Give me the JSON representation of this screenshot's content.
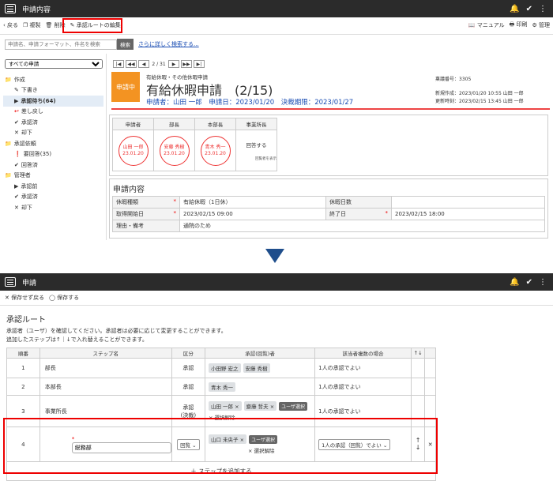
{
  "top": {
    "title": "申請内容",
    "toolbar": {
      "back": "戻る",
      "copy": "複製",
      "delete": "削除",
      "edit_route": "承認ルートの編集",
      "manual": "マニュアル",
      "print": "印刷",
      "admin": "管理"
    },
    "search": {
      "placeholder": "申請名、申請フォーマット、件名を検索",
      "button": "検索",
      "advanced": "さらに詳しく検索する..."
    },
    "filter": "すべての申請",
    "sidebar": [
      {
        "label": "作成",
        "level": 0,
        "icon": "folder"
      },
      {
        "label": "下書き",
        "level": 1,
        "icon": "pencil"
      },
      {
        "label": "承認待ち(64)",
        "level": 1,
        "icon": "triangle",
        "selected": true
      },
      {
        "label": "差し戻し",
        "level": 1,
        "icon": "return"
      },
      {
        "label": "承認済",
        "level": 1,
        "icon": "check"
      },
      {
        "label": "却下",
        "level": 1,
        "icon": "x"
      },
      {
        "label": "承認依頼",
        "level": 0,
        "icon": "folder"
      },
      {
        "label": "要回答(35)",
        "level": 1,
        "icon": "exclaim"
      },
      {
        "label": "回答済",
        "level": 1,
        "icon": "check"
      },
      {
        "label": "管理者",
        "level": 0,
        "icon": "folder"
      },
      {
        "label": "承認前",
        "level": 1,
        "icon": "triangle"
      },
      {
        "label": "承認済",
        "level": 1,
        "icon": "check"
      },
      {
        "label": "却下",
        "level": 1,
        "icon": "x"
      }
    ],
    "pager": {
      "page": "2 / 31"
    },
    "app": {
      "badge": "申請中",
      "category": "有給休暇・その他休暇申請",
      "title": "有給休暇申請　(2/15)",
      "meta": "申請者：山田 一郎　申請日：2023/01/20　決裁期限：2023/01/27",
      "serial": "稟議番号：3305",
      "created": "新規作成：2023/01/20 10:55 山田 一郎",
      "updated": "更新時刻：2023/02/15 13:45 山田 一郎"
    },
    "approvers": [
      {
        "role": "申請者",
        "name": "山田 一郎",
        "date": "23.01.20"
      },
      {
        "role": "部長",
        "name": "安藤 秀樹",
        "date": "23.01.20"
      },
      {
        "role": "本部長",
        "name": "青木 秀一",
        "date": "23.01.20"
      },
      {
        "role": "事業所長",
        "text": "回答する",
        "sub": "回覧者を表示"
      }
    ],
    "details": {
      "title": "申請内容",
      "rows": [
        {
          "l1": "休暇種類",
          "v1": "有給休暇（1日休）",
          "l2": "休暇日数",
          "v2": ""
        },
        {
          "l1": "取得開始日",
          "v1": "2023/02/15 09:00",
          "l2": "終了日",
          "v2": "2023/02/15 18:00"
        },
        {
          "l1": "理由・備考",
          "v1": "通院のため"
        }
      ]
    }
  },
  "bottom": {
    "title": "申請",
    "toolbar": {
      "nosave": "保存せず戻る",
      "save": "保存する"
    },
    "section": "承認ルート",
    "desc1": "承認者（ユーザ）を確認してください。承認者は必要に応じて変更することができます。",
    "desc2": "追加したステップは↑｜↓で入れ替えることができます。",
    "columns": [
      "順番",
      "ステップ名",
      "区分",
      "承認(回覧)者",
      "該当者複数の場合",
      "↑↓",
      ""
    ],
    "rows": [
      {
        "no": "1",
        "step": "部長",
        "kubun": "承認",
        "people": [
          "小田野 宏之",
          "安藤 秀樹"
        ],
        "multi": "1人の承認でよい"
      },
      {
        "no": "2",
        "step": "本部長",
        "kubun": "承認",
        "people": [
          "青木 秀一"
        ],
        "multi": "1人の承認でよい"
      },
      {
        "no": "3",
        "step": "事業所長",
        "kubun": "承認\n(決裁)",
        "people": [
          "山田 一郎 ×",
          "齋藤 哲夫 ×"
        ],
        "user_select": "ユーザ選択",
        "clear": "× 選択解除",
        "multi": "1人の承認でよい"
      },
      {
        "no": "4",
        "step": "総務部",
        "kubun": "回覧",
        "people": [
          "山口 未央子 ×"
        ],
        "user_select": "ユーザ選択",
        "clear": "× 選択解除",
        "multi": "1人の承認（回覧）でよい"
      }
    ],
    "add_step": "ステップを追加する"
  }
}
